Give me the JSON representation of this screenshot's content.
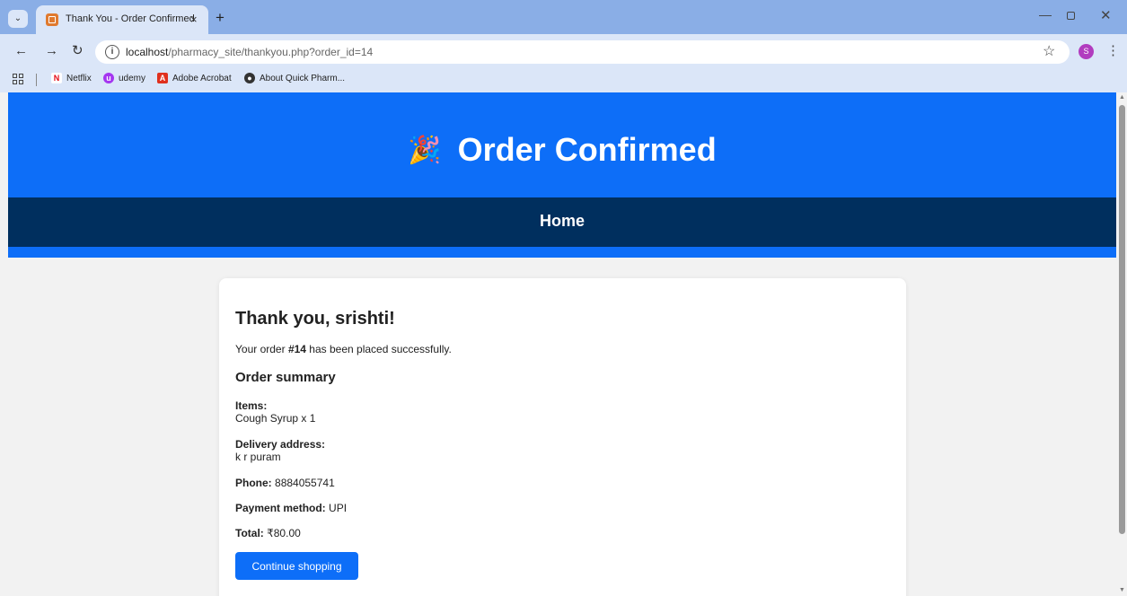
{
  "browser": {
    "tab_title": "Thank You - Order Confirmed",
    "tab_close": "×",
    "new_tab": "+",
    "url_host": "localhost",
    "url_path": "/pharmacy_site/thankyou.php?order_id=14",
    "profile_initial": "S",
    "bookmarks": [
      {
        "label": "Netflix",
        "icon": "netflix-icon",
        "color": "#e50914"
      },
      {
        "label": "udemy",
        "icon": "udemy-icon",
        "color": "#a435f0"
      },
      {
        "label": "Adobe Acrobat",
        "icon": "acrobat-icon",
        "color": "#e0301e"
      },
      {
        "label": "About Quick Pharm...",
        "icon": "globe-icon",
        "color": "#333333"
      }
    ]
  },
  "header": {
    "title": "Order Confirmed",
    "icon": "party-popper-icon",
    "bg_color": "#0d6ef8"
  },
  "nav": {
    "home": "Home",
    "bg_color": "#002f5e"
  },
  "card": {
    "greeting": "Thank you, srishti!",
    "order_prefix": "Your order ",
    "order_number": "#14",
    "order_suffix": " has been placed successfully.",
    "summary_heading": "Order summary",
    "items_label": "Items:",
    "items_value": "Cough Syrup x 1",
    "address_label": "Delivery address:",
    "address_value": "k r puram",
    "phone_label": "Phone:",
    "phone_value": "8884055741",
    "payment_label": "Payment method:",
    "payment_value": "UPI",
    "total_label": "Total:",
    "total_value": "₹80.00",
    "continue_button": "Continue shopping"
  }
}
